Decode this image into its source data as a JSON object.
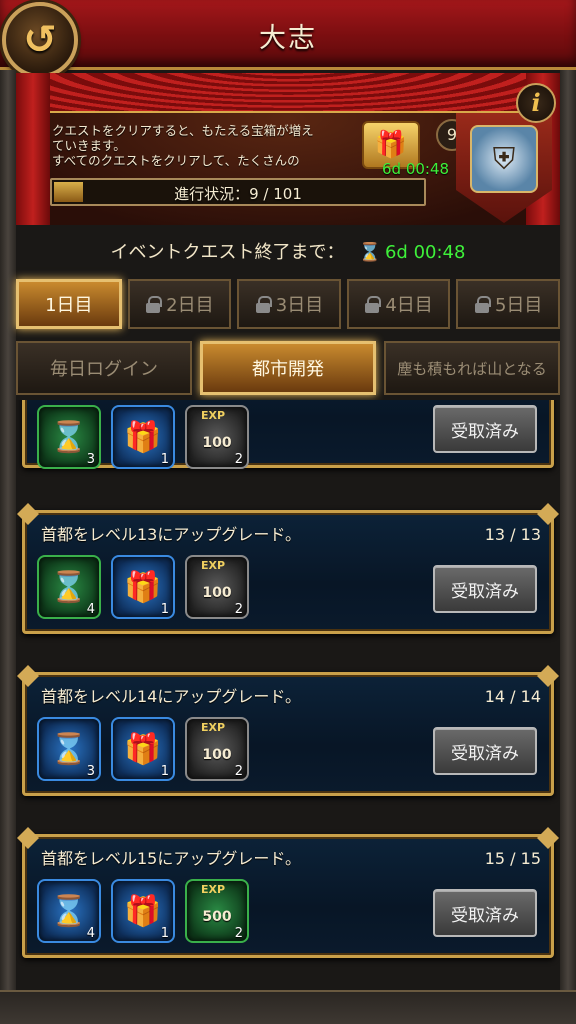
{
  "header": {
    "title": "大志",
    "back_icon": "back-arrow-icon"
  },
  "banner": {
    "description_line1": "クエストをクリアすると、もたえる宝箱が増え",
    "description_line2": "ていきます。",
    "description_line3": "すべてのクエストをクリアして、たくさんの",
    "chest_count": "9",
    "chest_timer": "6d 00:48",
    "progress_label": "進行状況：9 / 101",
    "progress_fraction": 0.09,
    "info_label": "i"
  },
  "event": {
    "label": "イベントクエスト終了まで：",
    "time": "6d 00:48"
  },
  "day_tabs": [
    {
      "label": "1日目",
      "locked": false,
      "active": true
    },
    {
      "label": "2日目",
      "locked": true,
      "active": false
    },
    {
      "label": "3日目",
      "locked": true,
      "active": false
    },
    {
      "label": "4日目",
      "locked": true,
      "active": false
    },
    {
      "label": "5日目",
      "locked": true,
      "active": false
    }
  ],
  "category_tabs": [
    {
      "label": "毎日ログイン",
      "active": false
    },
    {
      "label": "都市開発",
      "active": true
    },
    {
      "label": "塵も積もれば山となる",
      "active": false
    }
  ],
  "quests": [
    {
      "title": "",
      "progress": "",
      "rewards": [
        {
          "icon": "hourglass-icon",
          "color": "green",
          "qty": "3"
        },
        {
          "icon": "treasure-chest-icon",
          "color": "blue",
          "qty": "1"
        },
        {
          "icon": "exp-book-icon",
          "color": "gray",
          "exp_label": "EXP",
          "exp_value": "100",
          "qty": "2"
        }
      ],
      "button": "受取済み"
    },
    {
      "title": "首都をレベル13にアップグレード。",
      "progress": "13 / 13",
      "rewards": [
        {
          "icon": "hourglass-icon",
          "color": "green",
          "qty": "4"
        },
        {
          "icon": "treasure-chest-icon",
          "color": "blue",
          "qty": "1"
        },
        {
          "icon": "exp-book-icon",
          "color": "gray",
          "exp_label": "EXP",
          "exp_value": "100",
          "qty": "2"
        }
      ],
      "button": "受取済み"
    },
    {
      "title": "首都をレベル14にアップグレード。",
      "progress": "14 / 14",
      "rewards": [
        {
          "icon": "hourglass-icon",
          "color": "blue",
          "qty": "3"
        },
        {
          "icon": "treasure-chest-icon",
          "color": "blue",
          "qty": "1"
        },
        {
          "icon": "exp-book-icon",
          "color": "gray",
          "exp_label": "EXP",
          "exp_value": "100",
          "qty": "2"
        }
      ],
      "button": "受取済み"
    },
    {
      "title": "首都をレベル15にアップグレード。",
      "progress": "15 / 15",
      "rewards": [
        {
          "icon": "hourglass-icon",
          "color": "blue",
          "qty": "4"
        },
        {
          "icon": "treasure-chest-icon",
          "color": "blue",
          "qty": "1"
        },
        {
          "icon": "exp-book-icon",
          "color": "green",
          "exp_label": "EXP",
          "exp_value": "500",
          "qty": "2"
        }
      ],
      "button": "受取済み"
    }
  ],
  "colors": {
    "accent_gold": "#c9a04a",
    "timer_green": "#3ef03a",
    "header_red": "#a3171a"
  }
}
